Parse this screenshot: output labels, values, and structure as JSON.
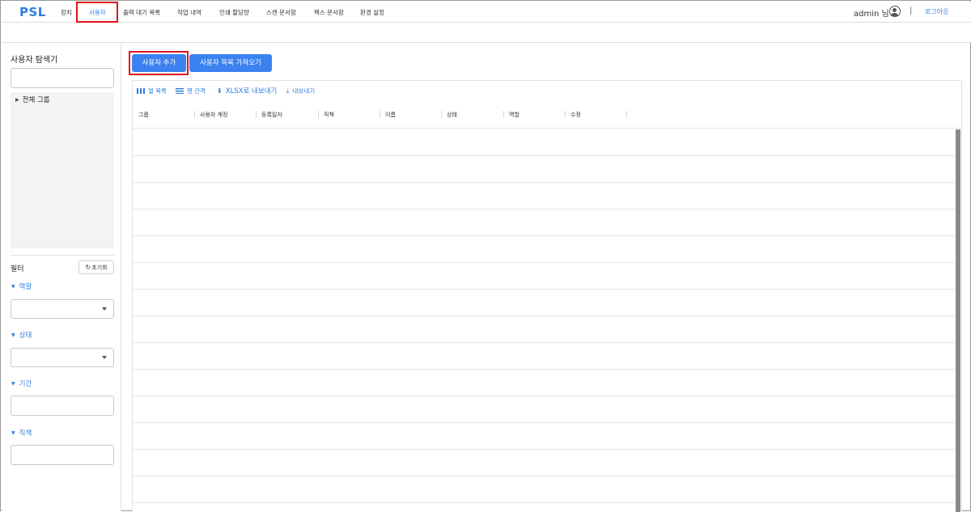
{
  "header": {
    "logo": "PSL",
    "nav": [
      {
        "label": "장치",
        "active": false
      },
      {
        "label": "사용자",
        "active": true
      },
      {
        "label": "출력 대기 목록",
        "active": false
      },
      {
        "label": "작업 내역",
        "active": false
      },
      {
        "label": "인쇄 할당량",
        "active": false
      },
      {
        "label": "스캔 문서함",
        "active": false
      },
      {
        "label": "팩스 문서함",
        "active": false
      },
      {
        "label": "환경 설정",
        "active": false
      }
    ],
    "user_label": "admin 님",
    "separator": "|",
    "logout_label": "로그아웃"
  },
  "sidebar": {
    "title": "사용자 탐색기",
    "search_value": "",
    "tree": [
      {
        "label": "전체 그룹",
        "expanded": false
      }
    ],
    "filter_title": "필터",
    "reset_label": "초기화",
    "filters": [
      {
        "label": "역할",
        "type": "select",
        "value": ""
      },
      {
        "label": "상태",
        "type": "select",
        "value": ""
      },
      {
        "label": "기간",
        "type": "input",
        "value": ""
      },
      {
        "label": "직책",
        "type": "input",
        "value": ""
      }
    ]
  },
  "main": {
    "buttons": {
      "add_user": "사용자 추가",
      "import_users": "사용자 목록 가져오기"
    },
    "toolbar": {
      "columns": "열 목록",
      "density": "행 간격",
      "export_xlsx": "XLSX로 내보내기",
      "export": "내보내기"
    },
    "columns": [
      "그룹",
      "사용자 계정",
      "등록일자",
      "직책",
      "이름",
      "상태",
      "역할",
      "수정"
    ],
    "rows": []
  },
  "colors": {
    "accent": "#3b82f0",
    "highlight": "#e0141b",
    "link": "#2f7de1"
  }
}
